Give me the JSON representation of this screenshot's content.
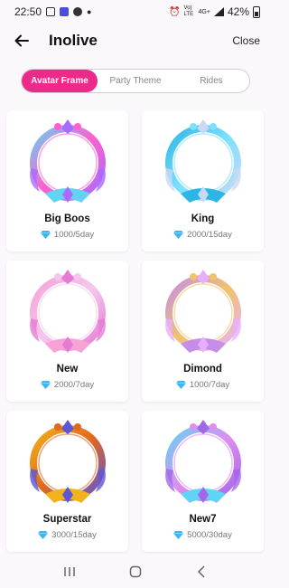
{
  "status": {
    "time": "22:50",
    "network": "Vo) LTE",
    "signal": "4G+",
    "battery": "42%"
  },
  "header": {
    "title": "Inolive",
    "close_label": "Close"
  },
  "tabs": [
    {
      "label": "Avatar Frame",
      "active": true
    },
    {
      "label": "Party Theme",
      "active": false
    },
    {
      "label": "Rides",
      "active": false
    }
  ],
  "items": [
    {
      "name": "Big Boos",
      "price": "1000/5day",
      "colors": [
        "#62d3f0",
        "#ff5fd0",
        "#a86bff"
      ]
    },
    {
      "name": "King",
      "price": "2000/15day",
      "colors": [
        "#2bb6e6",
        "#7ee0ff",
        "#c8d9f5"
      ]
    },
    {
      "name": "New",
      "price": "2000/7day",
      "colors": [
        "#f6a2d6",
        "#f5c7ec",
        "#e57ad4"
      ]
    },
    {
      "name": "Dimond",
      "price": "1000/7day",
      "colors": [
        "#c58de8",
        "#f1c36a",
        "#e7b0ff"
      ]
    },
    {
      "name": "Superstar",
      "price": "3000/15day",
      "colors": [
        "#f3b21a",
        "#e1671c",
        "#5c56d8"
      ]
    },
    {
      "name": "New7",
      "price": "5000/30day",
      "colors": [
        "#5fd4f5",
        "#e08df0",
        "#a267e8"
      ]
    }
  ],
  "icons": {
    "back": "arrow-left-icon",
    "price": "diamond-icon",
    "nav": [
      "recents-icon",
      "home-icon",
      "back-nav-icon"
    ]
  }
}
